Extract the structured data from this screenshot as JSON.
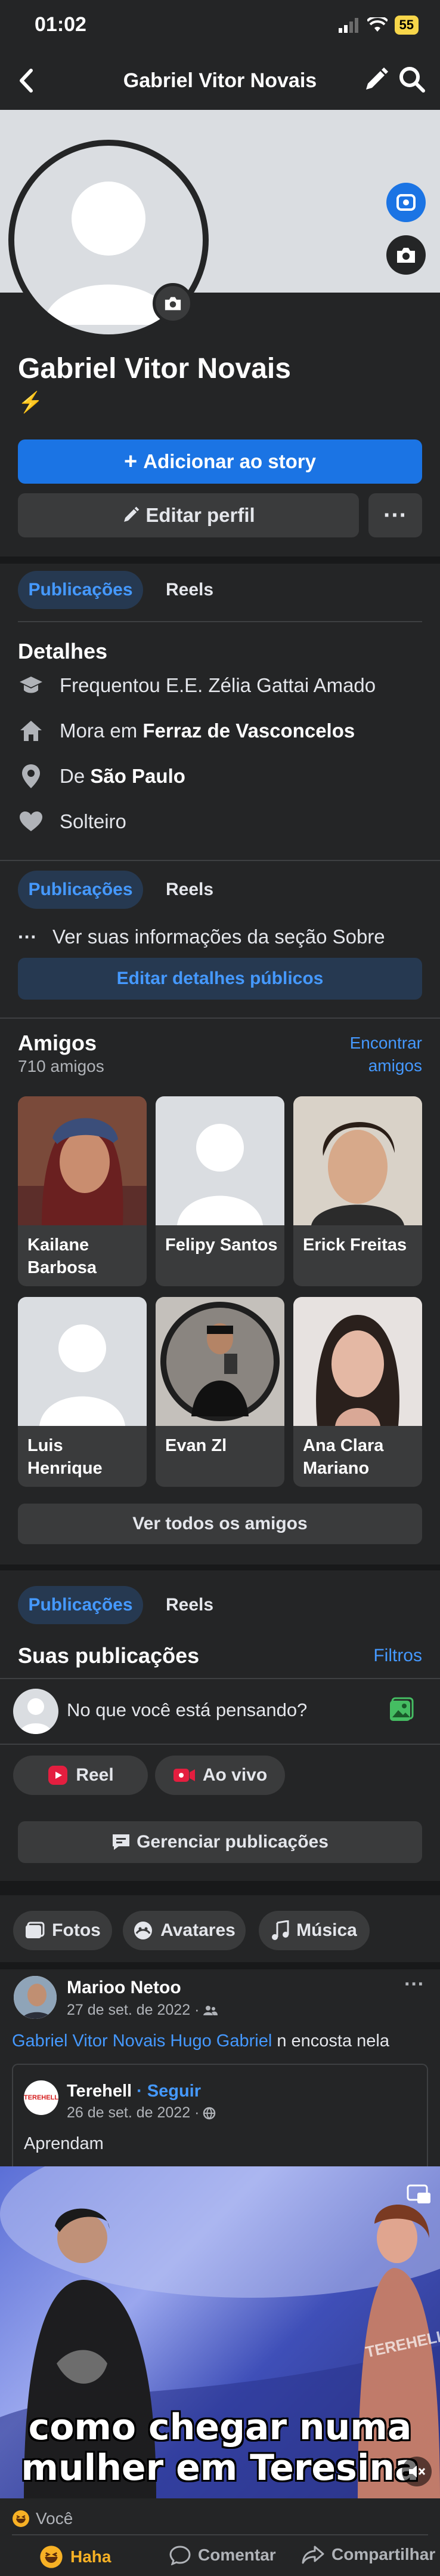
{
  "status_bar": {
    "time": "01:02",
    "battery": "55"
  },
  "header": {
    "title": "Gabriel Vitor Novais"
  },
  "profile": {
    "name": "Gabriel Vitor Novais",
    "bio_emoji": "⚡",
    "add_story_label": "Adicionar ao story",
    "edit_profile_label": "Editar perfil",
    "more_label": "···"
  },
  "tabs": {
    "posts": "Publicações",
    "reels": "Reels"
  },
  "details": {
    "title": "Detalhes",
    "studied_prefix": "Frequentou E.E. Zélia Gattai Amado",
    "lives_prefix": "Mora em ",
    "lives_place": "Ferraz de Vasconcelos",
    "from_prefix": "De ",
    "from_place": "São Paulo",
    "relationship": "Solteiro",
    "see_about": "Ver suas informações da seção Sobre",
    "edit_public": "Editar detalhes públicos"
  },
  "friends": {
    "title": "Amigos",
    "count": "710 amigos",
    "find_line1": "Encontrar",
    "find_line2": "amigos",
    "see_all": "Ver todos os amigos",
    "items": [
      {
        "name": "Kailane Barbosa"
      },
      {
        "name": "Felipy Santos"
      },
      {
        "name": "Erick Freitas"
      },
      {
        "name": "Luis Henrique"
      },
      {
        "name": "Evan Zl"
      },
      {
        "name": "Ana Clara Mariano"
      }
    ]
  },
  "posts_section": {
    "title": "Suas publicações",
    "filters": "Filtros",
    "composer_placeholder": "No que você está pensando?",
    "reel": "Reel",
    "live": "Ao vivo",
    "manage": "Gerenciar publicações",
    "chips": [
      "Fotos",
      "Avatares",
      "Música"
    ]
  },
  "post": {
    "author": "Marioo Netoo",
    "date": "27 de set. de 2022 ·",
    "tag1": "Gabriel Vitor Novais",
    "tag2": "Hugo Gabriel",
    "text": "n encosta nela",
    "shared_author": "Terehell",
    "follow": "· Seguir",
    "shared_date": "26 de set. de 2022 ·",
    "shared_text": "Aprendam",
    "caption_line1": "como chegar numa",
    "caption_line2": "mulher em Teresina",
    "video_watermark": "TEREHELL",
    "reaction_by": "Você",
    "like": "Haha",
    "comment": "Comentar",
    "share": "Compartilhar"
  },
  "colors": {
    "accent": "#1b74e4",
    "link": "#4599ff",
    "background": "#242526",
    "surface": "#3a3b3c"
  }
}
